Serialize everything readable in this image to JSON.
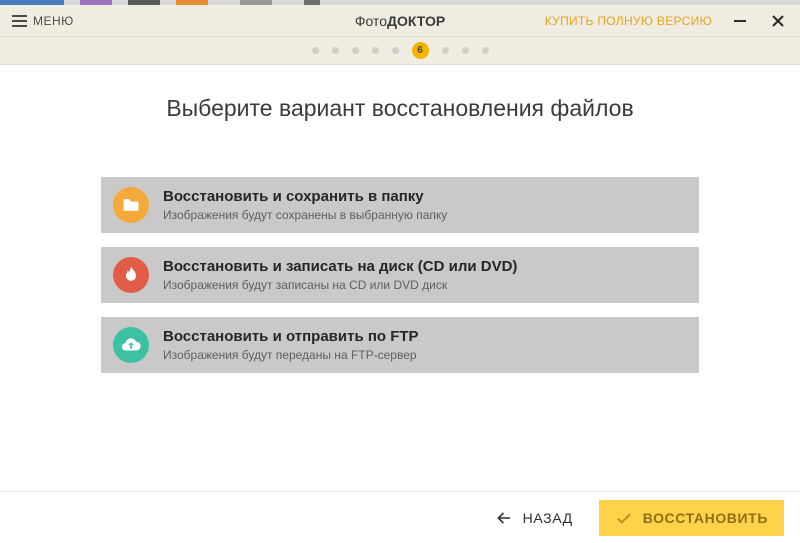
{
  "header": {
    "menu_label": "МЕНЮ",
    "app_title_prefix": "Фото",
    "app_title_strong": "ДОКТОР",
    "buy_label": "КУПИТЬ ПОЛНУЮ ВЕРСИЮ"
  },
  "stepper": {
    "current": 6,
    "total": 9,
    "current_label": "6"
  },
  "page": {
    "title": "Выберите вариант восстановления файлов"
  },
  "options": [
    {
      "id": "folder",
      "title": "Восстановить и сохранить в папку",
      "caption": "Изображения будут сохранены в выбранную папку"
    },
    {
      "id": "disc",
      "title": "Восстановить и записать на диск (CD или DVD)",
      "caption": "Изображения будут записаны на CD или DVD диск"
    },
    {
      "id": "ftp",
      "title": "Восстановить и отправить по FTP",
      "caption": "Изображения будут переданы на FTP-сервер"
    }
  ],
  "footer": {
    "back_label": "НАЗАД",
    "restore_label": "ВОССТАНОВИТЬ"
  }
}
